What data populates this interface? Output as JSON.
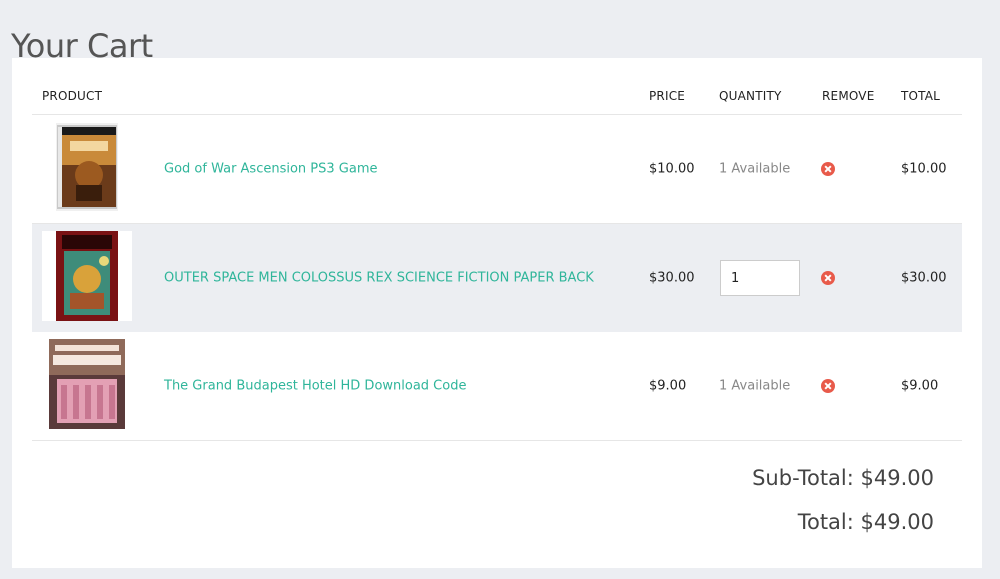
{
  "page": {
    "title": "Your Cart"
  },
  "table": {
    "headers": {
      "product": "PRODUCT",
      "price": "PRICE",
      "quantity": "QUANTITY",
      "remove": "REMOVE",
      "total": "TOTAL"
    },
    "rows": [
      {
        "name": "God of War Ascension PS3 Game",
        "price": "$10.00",
        "quantity_text": "1 Available",
        "total": "$10.00",
        "thumb_icon": "game-case-image"
      },
      {
        "name": "OUTER SPACE MEN COLOSSUS REX SCIENCE FICTION PAPER BACK",
        "price": "$30.00",
        "quantity_value": "1",
        "total": "$30.00",
        "thumb_icon": "paperback-cover-image"
      },
      {
        "name": "The Grand Budapest Hotel HD Download Code",
        "price": "$9.00",
        "quantity_text": "1 Available",
        "total": "$9.00",
        "thumb_icon": "movie-poster-image"
      }
    ]
  },
  "summary": {
    "subtotal": "Sub-Total: $49.00",
    "total": "Total: $49.00"
  },
  "colors": {
    "link": "#2fb59a",
    "remove": "#e85a4a",
    "background": "#eceef2"
  }
}
